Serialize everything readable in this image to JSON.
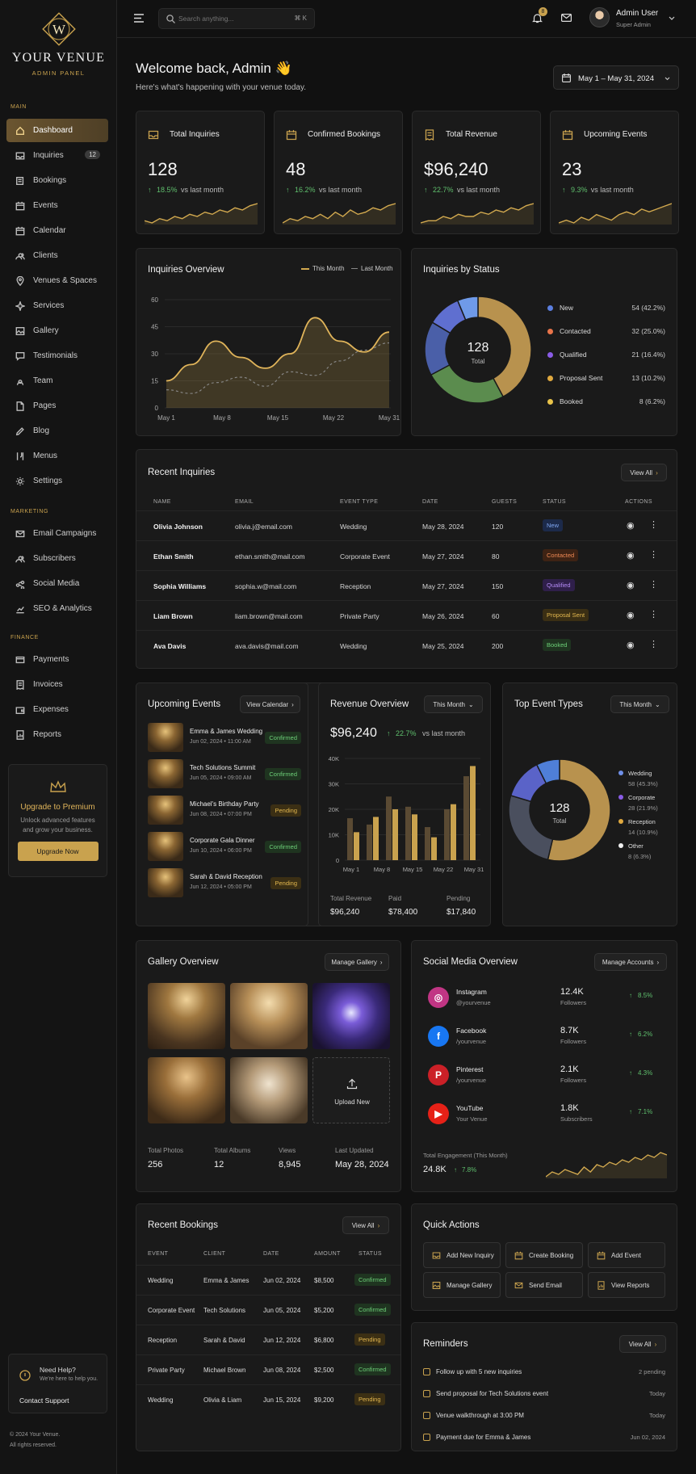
{
  "brand": {
    "name": "YOUR VENUE",
    "sub": "ADMIN PANEL",
    "monogram": "W"
  },
  "colors": {
    "gold": "#c9a24e",
    "bg": "#111111",
    "card": "#1a1a1a",
    "green": "#5fbf6d"
  },
  "sidebar": {
    "sections": {
      "main": "MAIN",
      "marketing": "MARKETING",
      "finance": "FINANCE"
    },
    "main_items": [
      {
        "label": "Dashboard",
        "icon": "home-icon"
      },
      {
        "label": "Inquiries",
        "icon": "inbox-icon",
        "count": "12"
      },
      {
        "label": "Bookings",
        "icon": "book-icon"
      },
      {
        "label": "Events",
        "icon": "calendar-icon"
      },
      {
        "label": "Calendar",
        "icon": "calendar-icon"
      },
      {
        "label": "Clients",
        "icon": "users-icon"
      },
      {
        "label": "Venues & Spaces",
        "icon": "location-icon"
      },
      {
        "label": "Services",
        "icon": "sparkle-icon"
      },
      {
        "label": "Gallery",
        "icon": "image-icon"
      },
      {
        "label": "Testimonials",
        "icon": "chat-icon"
      },
      {
        "label": "Team",
        "icon": "team-icon"
      },
      {
        "label": "Pages",
        "icon": "page-icon"
      },
      {
        "label": "Blog",
        "icon": "pen-icon"
      },
      {
        "label": "Menus",
        "icon": "menu-icon"
      },
      {
        "label": "Settings",
        "icon": "gear-icon"
      }
    ],
    "marketing_items": [
      {
        "label": "Email Campaigns",
        "icon": "mail-icon"
      },
      {
        "label": "Subscribers",
        "icon": "users-icon"
      },
      {
        "label": "Social Media",
        "icon": "share-icon"
      },
      {
        "label": "SEO & Analytics",
        "icon": "chart-icon"
      }
    ],
    "finance_items": [
      {
        "label": "Payments",
        "icon": "card-icon"
      },
      {
        "label": "Invoices",
        "icon": "invoice-icon"
      },
      {
        "label": "Expenses",
        "icon": "wallet-icon"
      },
      {
        "label": "Reports",
        "icon": "report-icon"
      }
    ],
    "premium": {
      "title": "Upgrade to Premium",
      "text1": "Unlock advanced features",
      "text2": "and grow your business.",
      "button": "Upgrade Now"
    },
    "help": {
      "title": "Need Help?",
      "text": "We're here to help you.",
      "link": "Contact Support"
    },
    "footer1": "© 2024 Your Venue.",
    "footer2": "All rights reserved."
  },
  "topbar": {
    "search_placeholder": "Search anything...",
    "shortcut": "⌘ K",
    "notif_count": "8",
    "user_name": "Admin User",
    "user_role": "Super Admin"
  },
  "header": {
    "welcome": "Welcome back, Admin 👋",
    "subtitle": "Here's what's happening with your venue today.",
    "date_range": "May 1 – May 31, 2024"
  },
  "stats": [
    {
      "label": "Total Inquiries",
      "value": "128",
      "change": "18.5%",
      "note": "vs last month",
      "spark": [
        12,
        11,
        13,
        12,
        14,
        13,
        15,
        14,
        16,
        15,
        17,
        16,
        18,
        17,
        19,
        20
      ]
    },
    {
      "label": "Confirmed Bookings",
      "value": "48",
      "change": "16.2%",
      "note": "vs last month",
      "spark": [
        10,
        12,
        11,
        13,
        12,
        14,
        12,
        15,
        13,
        16,
        14,
        15,
        17,
        16,
        18,
        19
      ]
    },
    {
      "label": "Total Revenue",
      "value": "$96,240",
      "change": "22.7%",
      "note": "vs last month",
      "spark": [
        11,
        12,
        12,
        14,
        13,
        15,
        14,
        14,
        16,
        15,
        17,
        16,
        18,
        17,
        19,
        20
      ]
    },
    {
      "label": "Upcoming Events",
      "value": "23",
      "change": "9.3%",
      "note": "vs last month",
      "spark": [
        12,
        13,
        12,
        14,
        13,
        15,
        14,
        13,
        15,
        16,
        15,
        17,
        16,
        17,
        18,
        19
      ]
    }
  ],
  "inquiries_overview": {
    "title": "Inquiries Overview",
    "legend_this": "This Month",
    "legend_last": "Last Month",
    "chart_data": {
      "type": "line",
      "x": [
        "May 1",
        "May 4",
        "May 8",
        "May 11",
        "May 15",
        "May 18",
        "May 22",
        "May 25",
        "May 28",
        "May 31"
      ],
      "x_ticks": [
        "May 1",
        "May 8",
        "May 15",
        "May 22",
        "May 31"
      ],
      "ylim": [
        0,
        60
      ],
      "y_ticks": [
        "0",
        "15",
        "30",
        "45",
        "60"
      ],
      "series": [
        {
          "name": "This Month",
          "values": [
            15,
            24,
            37,
            28,
            22,
            30,
            50,
            37,
            31,
            42
          ]
        },
        {
          "name": "Last Month",
          "values": [
            10,
            8,
            14,
            17,
            12,
            20,
            18,
            26,
            32,
            36
          ]
        }
      ]
    }
  },
  "status": {
    "title": "Inquiries by Status",
    "total": "128",
    "total_label": "Total",
    "chart_data": {
      "type": "pie",
      "labels": [
        "New",
        "Contacted",
        "Qualified",
        "Proposal Sent",
        "Booked"
      ],
      "values": [
        54,
        32,
        21,
        13,
        8
      ],
      "display": [
        "54 (42.2%)",
        "32 (25.0%)",
        "21 (16.4%)",
        "13 (10.2%)",
        "8 (6.2%)"
      ],
      "legend_colors": [
        "#5b7fe0",
        "#e8744a",
        "#8a5ce6",
        "#e0a93f",
        "#e8c34a"
      ],
      "ring_colors": [
        "#b8924e",
        "#5b8c4e",
        "#4a5fa8",
        "#5f6fd0",
        "#6f9ae8"
      ]
    }
  },
  "recent_inquiries": {
    "title": "Recent Inquiries",
    "view_all": "View All",
    "headers": [
      "NAME",
      "EMAIL",
      "EVENT TYPE",
      "DATE",
      "GUESTS",
      "STATUS",
      "ACTIONS"
    ],
    "rows": [
      {
        "name": "Olivia Johnson",
        "email": "olivia.j@email.com",
        "type": "Wedding",
        "date": "May 28, 2024",
        "guests": "120",
        "status": "New",
        "cls": "b-new"
      },
      {
        "name": "Ethan Smith",
        "email": "ethan.smith@mail.com",
        "type": "Corporate Event",
        "date": "May 27, 2024",
        "guests": "80",
        "status": "Contacted",
        "cls": "b-cont"
      },
      {
        "name": "Sophia Williams",
        "email": "sophia.w@mail.com",
        "type": "Reception",
        "date": "May 27, 2024",
        "guests": "150",
        "status": "Qualified",
        "cls": "b-qual"
      },
      {
        "name": "Liam Brown",
        "email": "liam.brown@mail.com",
        "type": "Private Party",
        "date": "May 26, 2024",
        "guests": "60",
        "status": "Proposal Sent",
        "cls": "b-pend"
      },
      {
        "name": "Ava Davis",
        "email": "ava.davis@mail.com",
        "type": "Wedding",
        "date": "May 25, 2024",
        "guests": "200",
        "status": "Booked",
        "cls": "b-book"
      }
    ]
  },
  "upcoming": {
    "title": "Upcoming Events",
    "button": "View Calendar",
    "items": [
      {
        "name": "Emma & James Wedding",
        "when": "Jun 02, 2024 • 11:00 AM",
        "status": "Confirmed",
        "cls": "b-conf"
      },
      {
        "name": "Tech Solutions Summit",
        "when": "Jun 05, 2024 • 09:00 AM",
        "status": "Confirmed",
        "cls": "b-conf"
      },
      {
        "name": "Michael's Birthday Party",
        "when": "Jun 08, 2024 • 07:00 PM",
        "status": "Pending",
        "cls": "b-pend"
      },
      {
        "name": "Corporate Gala Dinner",
        "when": "Jun 10, 2024 • 06:00 PM",
        "status": "Confirmed",
        "cls": "b-conf"
      },
      {
        "name": "Sarah & David Reception",
        "when": "Jun 12, 2024 • 05:00 PM",
        "status": "Pending",
        "cls": "b-pend"
      }
    ]
  },
  "revenue": {
    "title": "Revenue Overview",
    "period": "This Month",
    "value": "$96,240",
    "change": "22.7%",
    "note": "vs last month",
    "totals": [
      {
        "label": "Total Revenue",
        "value": "$96,240"
      },
      {
        "label": "Paid",
        "value": "$78,400"
      },
      {
        "label": "Pending",
        "value": "$17,840"
      }
    ],
    "chart_data": {
      "type": "bar",
      "x_ticks": [
        "May 1",
        "May 8",
        "May 15",
        "May 22",
        "May 31"
      ],
      "ylim": [
        0,
        40000
      ],
      "y_ticks": [
        "0",
        "10K",
        "20K",
        "30K",
        "40K"
      ],
      "series": [
        {
          "name": "",
          "values": [
            16500,
            14000,
            25000,
            21000,
            13000,
            20000,
            33000
          ]
        },
        {
          "name": "",
          "values": [
            11000,
            17000,
            20000,
            18000,
            9000,
            22000,
            37000
          ]
        }
      ]
    }
  },
  "event_types": {
    "title": "Top Event Types",
    "period": "This Month",
    "total": "128",
    "total_label": "Total",
    "chart_data": {
      "type": "pie",
      "labels": [
        "Wedding",
        "Corporate",
        "Reception",
        "Other"
      ],
      "values": [
        58,
        28,
        14,
        8
      ],
      "display": [
        "58 (45.3%)",
        "28 (21.9%)",
        "14 (10.9%)",
        "8 (6.3%)"
      ],
      "legend_colors": [
        "#6f8fe8",
        "#8a5ce6",
        "#e0a93f",
        "#f0f0f0"
      ],
      "ring_colors": [
        "#b8924e",
        "#4a4f5e",
        "#5a63c8",
        "#4f7fd8",
        "#6fa0ee"
      ]
    }
  },
  "gallery": {
    "title": "Gallery Overview",
    "button": "Manage Gallery",
    "upload": "Upload New",
    "stats": [
      {
        "label": "Total Photos",
        "value": "256"
      },
      {
        "label": "Total Albums",
        "value": "12"
      },
      {
        "label": "Views",
        "value": "8,945"
      },
      {
        "label": "Last Updated",
        "value": "May 28, 2024"
      }
    ]
  },
  "social": {
    "title": "Social Media Overview",
    "button": "Manage Accounts",
    "items": [
      {
        "name": "Instagram",
        "handle": "@yourvenue",
        "count": "12.4K",
        "unit": "Followers",
        "change": "8.5%",
        "color": "#c13584",
        "glyph": "◎"
      },
      {
        "name": "Facebook",
        "handle": "/yourvenue",
        "count": "8.7K",
        "unit": "Followers",
        "change": "6.2%",
        "color": "#1877f2",
        "glyph": "f"
      },
      {
        "name": "Pinterest",
        "handle": "/yourvenue",
        "count": "2.1K",
        "unit": "Followers",
        "change": "4.3%",
        "color": "#cb2027",
        "glyph": "P"
      },
      {
        "name": "YouTube",
        "handle": "Your Venue",
        "count": "1.8K",
        "unit": "Subscribers",
        "change": "7.1%",
        "color": "#e62117",
        "glyph": "▶"
      }
    ],
    "engagement_label": "Total Engagement (This Month)",
    "engagement_value": "24.8K",
    "engagement_change": "7.8%",
    "spark": [
      10,
      12,
      11,
      13,
      12,
      11,
      14,
      12,
      15,
      14,
      16,
      15,
      17,
      16,
      18,
      17,
      19,
      18,
      20,
      19
    ]
  },
  "bookings": {
    "title": "Recent Bookings",
    "view_all": "View All",
    "headers": [
      "EVENT",
      "CLIENT",
      "DATE",
      "AMOUNT",
      "STATUS"
    ],
    "rows": [
      {
        "event": "Wedding",
        "client": "Emma & James",
        "date": "Jun 02, 2024",
        "amount": "$8,500",
        "status": "Confirmed",
        "cls": "b-conf"
      },
      {
        "event": "Corporate Event",
        "client": "Tech Solutions",
        "date": "Jun 05, 2024",
        "amount": "$5,200",
        "status": "Confirmed",
        "cls": "b-conf"
      },
      {
        "event": "Reception",
        "client": "Sarah & David",
        "date": "Jun 12, 2024",
        "amount": "$6,800",
        "status": "Pending",
        "cls": "b-pend"
      },
      {
        "event": "Private Party",
        "client": "Michael Brown",
        "date": "Jun 08, 2024",
        "amount": "$2,500",
        "status": "Confirmed",
        "cls": "b-conf"
      },
      {
        "event": "Wedding",
        "client": "Olivia & Liam",
        "date": "Jun 15, 2024",
        "amount": "$9,200",
        "status": "Pending",
        "cls": "b-pend"
      }
    ]
  },
  "quick_actions": {
    "title": "Quick Actions",
    "items": [
      "Add New Inquiry",
      "Create Booking",
      "Add Event",
      "Manage Gallery",
      "Send Email",
      "View Reports"
    ]
  },
  "reminders": {
    "title": "Reminders",
    "view_all": "View All",
    "items": [
      {
        "text": "Follow up with 5 new inquiries",
        "when": "2 pending"
      },
      {
        "text": "Send proposal for Tech Solutions event",
        "when": "Today"
      },
      {
        "text": "Venue walkthrough at 3:00 PM",
        "when": "Today"
      },
      {
        "text": "Payment due for Emma & James",
        "when": "Jun 02, 2024"
      }
    ]
  }
}
